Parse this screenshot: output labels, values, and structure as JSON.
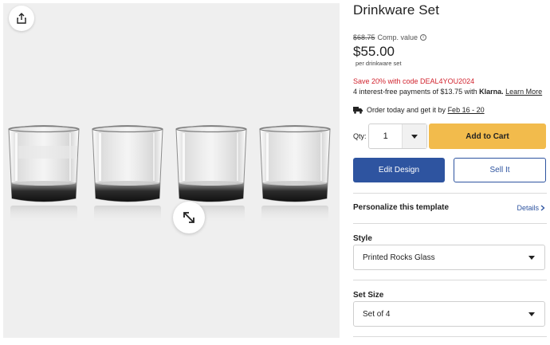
{
  "product": {
    "title": "Drinkware Set",
    "comp_price": "$68.75",
    "comp_label": "Comp. value",
    "price": "$55.00",
    "per_unit": "per drinkware set",
    "promo": "Save 20% with code DEAL4YOU2024",
    "klarna_prefix": "4 interest-free payments of $13.75 with ",
    "klarna_brand": "Klarna.",
    "klarna_link": "Learn More",
    "delivery_prefix": "Order today and get it by ",
    "delivery_date": "Feb 16 - 20"
  },
  "purchase": {
    "qty_label": "Qty:",
    "qty_value": "1",
    "add_to_cart": "Add to Cart",
    "edit_design": "Edit Design",
    "sell_it": "Sell It"
  },
  "personalize": {
    "label": "Personalize this template",
    "details": "Details"
  },
  "style": {
    "label": "Style",
    "selected": "Printed Rocks Glass"
  },
  "set_size": {
    "label": "Set Size",
    "selected": "Set of 4"
  },
  "gallery": {
    "glass_count": 4
  },
  "icons": {
    "share": "share-icon",
    "expand": "expand-icon",
    "info": "info-icon",
    "truck": "truck-icon",
    "caret": "caret-down-icon",
    "chevron": "chevron-right-icon"
  },
  "colors": {
    "cart_button": "#f2bb4c",
    "primary_blue": "#2e54a0",
    "promo_red": "#d1242f",
    "gallery_bg": "#efefef"
  }
}
